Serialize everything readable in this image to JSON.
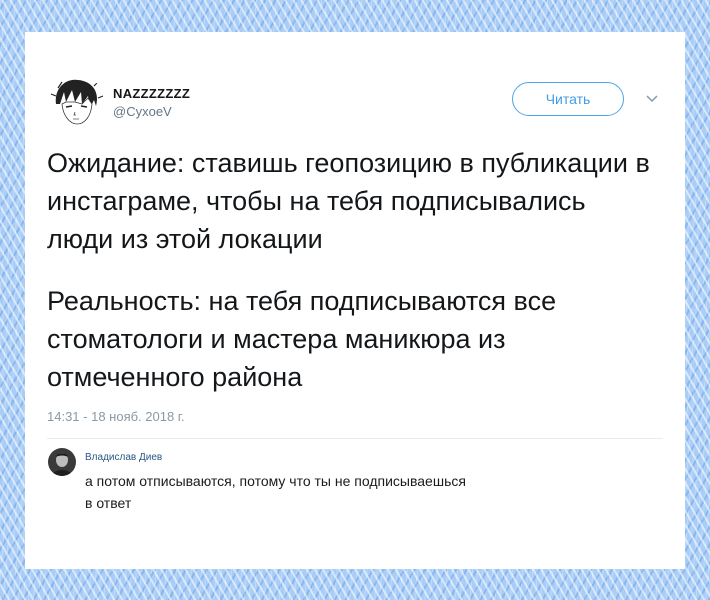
{
  "tweet": {
    "author_name": "NAZZZZZZZ",
    "author_handle": "@CyxoeV",
    "follow_label": "Читать",
    "paragraphs": [
      "Ожидание: ставишь геопозицию в публикации в инстаграме, чтобы на тебя подписывались люди из этой локации",
      "Реальность: на тебя подписываются все стоматологи и мастера маникюра из отмеченного района"
    ],
    "timestamp": "14:31 - 18 нояб. 2018 г."
  },
  "reply": {
    "author_name": "Владислав Диев",
    "text": "а потом отписываются, потому что ты не подписываешься",
    "reply_link": "в ответ"
  },
  "colors": {
    "accent": "#4aa5ea",
    "text": "#14171a",
    "muted": "#8899a6",
    "link": "#2a5885",
    "background": "#a9cdf6"
  },
  "icons": {
    "avatar": "anime-face-avatar",
    "menu": "chevron-down-icon",
    "reply_avatar": "user-photo-avatar"
  }
}
